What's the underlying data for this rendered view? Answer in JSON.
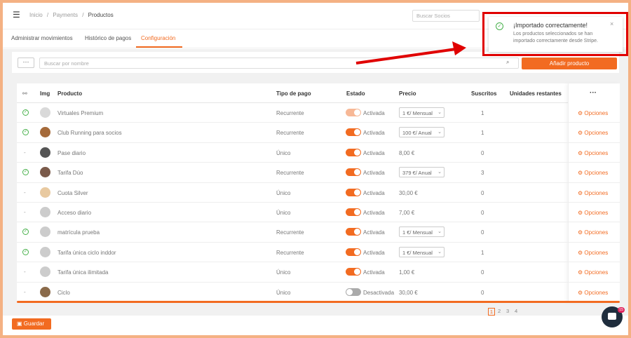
{
  "breadcrumb": [
    "Inicio",
    "/",
    "Payments",
    "/",
    "Productos"
  ],
  "header": {
    "search_placeholder": "Buscar Socios"
  },
  "tabs": [
    {
      "label": "Administrar movimientos"
    },
    {
      "label": "Histórico de pagos"
    },
    {
      "label": "Configuración"
    }
  ],
  "toolbar": {
    "more_label": "···",
    "search_placeholder": "Buscar por nombre",
    "add_label": "Añadir producto"
  },
  "table": {
    "headers": {
      "link": "",
      "img": "Img",
      "producto": "Producto",
      "tipo": "Tipo de pago",
      "estado": "Estado",
      "precio": "Precio",
      "suscritos": "Suscritos",
      "unidades": "Unidades restantes",
      "more": "···"
    },
    "rows": [
      {
        "linked": true,
        "producto": "Virtuales Premium",
        "tipo": "Recurrente",
        "estado": "Activada",
        "toggle": "light",
        "precio": "1 €/ Mensual",
        "precio_select": true,
        "suscritos": "1",
        "avatar": "#d9d9d9"
      },
      {
        "linked": true,
        "producto": "Club Running para socios",
        "tipo": "Recurrente",
        "estado": "Activada",
        "toggle": "on",
        "precio": "100 €/ Anual",
        "precio_select": true,
        "suscritos": "1",
        "avatar": "#a56a3a"
      },
      {
        "linked": false,
        "producto": "Pase diario",
        "tipo": "Único",
        "estado": "Activada",
        "toggle": "on",
        "precio": "8,00 €",
        "precio_select": false,
        "suscritos": "0",
        "avatar": "#555"
      },
      {
        "linked": true,
        "producto": "Tarifa Dúo",
        "tipo": "Recurrente",
        "estado": "Activada",
        "toggle": "on",
        "precio": "379 €/ Anual",
        "precio_select": true,
        "suscritos": "3",
        "avatar": "#7a5a4a"
      },
      {
        "linked": false,
        "producto": "Cuota Silver",
        "tipo": "Único",
        "estado": "Activada",
        "toggle": "on",
        "precio": "30,00 €",
        "precio_select": false,
        "suscritos": "0",
        "avatar": "#e8c9a0"
      },
      {
        "linked": false,
        "producto": "Acceso diario",
        "tipo": "Único",
        "estado": "Activada",
        "toggle": "on",
        "precio": "7,00 €",
        "precio_select": false,
        "suscritos": "0",
        "avatar": "#ccc"
      },
      {
        "linked": true,
        "producto": "matrícula prueba",
        "tipo": "Recurrente",
        "estado": "Activada",
        "toggle": "on",
        "precio": "1 €/ Mensual",
        "precio_select": true,
        "suscritos": "0",
        "avatar": "#ccc"
      },
      {
        "linked": true,
        "producto": "Tarifa única ciclo inddor",
        "tipo": "Recurrente",
        "estado": "Activada",
        "toggle": "on",
        "precio": "1 €/ Mensual",
        "precio_select": true,
        "suscritos": "1",
        "avatar": "#ccc"
      },
      {
        "linked": false,
        "producto": "Tarifa única ilimitada",
        "tipo": "Único",
        "estado": "Activada",
        "toggle": "on",
        "precio": "1,00 €",
        "precio_select": false,
        "suscritos": "0",
        "avatar": "#ccc"
      },
      {
        "linked": false,
        "producto": "Ciclo",
        "tipo": "Único",
        "estado": "Desactivada",
        "toggle": "off",
        "precio": "30,00 €",
        "precio_select": false,
        "suscritos": "0",
        "avatar": "#8a6a4a"
      }
    ],
    "options_label": "Opciones"
  },
  "pagination": {
    "pages": [
      "1",
      "2",
      "3",
      "4"
    ]
  },
  "footer": {
    "save_label": "Guardar"
  },
  "chat": {
    "badge": "15"
  },
  "toast": {
    "title": "¡Importado correctamente!",
    "message": "Los productos seleccionados se han importado correctamente desde Stripe.",
    "close": "×"
  },
  "colors": {
    "accent": "#f26b21",
    "success": "#46b04a",
    "highlight": "#e00000",
    "frame": "#f4b183"
  }
}
